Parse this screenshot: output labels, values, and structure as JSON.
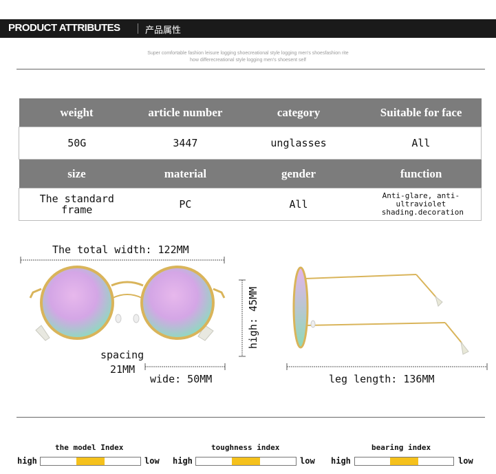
{
  "header": {
    "title_en": "PRODUCT ATTRIBUTES",
    "title_cn": "产品属性"
  },
  "subtitle": {
    "line1": "Super comfortable fashion leisure logging shoecreational style logging men's shoesfashion rite",
    "line2": "how differecreational style logging men's shoesent self"
  },
  "attributes": {
    "row1_headers": [
      "weight",
      "article number",
      "category",
      "Suitable for face"
    ],
    "row1_values": [
      "50G",
      "3447",
      "unglasses",
      "All"
    ],
    "row2_headers": [
      "size",
      "material",
      "gender",
      "function"
    ],
    "row2_values": [
      "The standard frame",
      "PC",
      "All",
      "Anti-glare, anti-ultraviolet shading.decoration"
    ]
  },
  "dimensions": {
    "total_width": "The total width: 122MM",
    "spacing_label": "spacing",
    "spacing_value": "21MM",
    "wide": "wide: 50MM",
    "high": "high: 45MM",
    "leg_length": "leg length: 136MM"
  },
  "indexes": [
    {
      "title": "the model Index",
      "high": "high",
      "low": "low",
      "level": 0.5
    },
    {
      "title": "toughness index",
      "high": "high",
      "low": "low",
      "level": 0.5
    },
    {
      "title": "bearing index",
      "high": "high",
      "low": "low",
      "level": 0.5
    }
  ],
  "colors": {
    "header_bg": "#1a1a1a",
    "table_header_bg": "#7c7c7c",
    "index_fill": "#f5c11c",
    "lens": "#d8a8e8",
    "frame": "#d9b45a"
  }
}
